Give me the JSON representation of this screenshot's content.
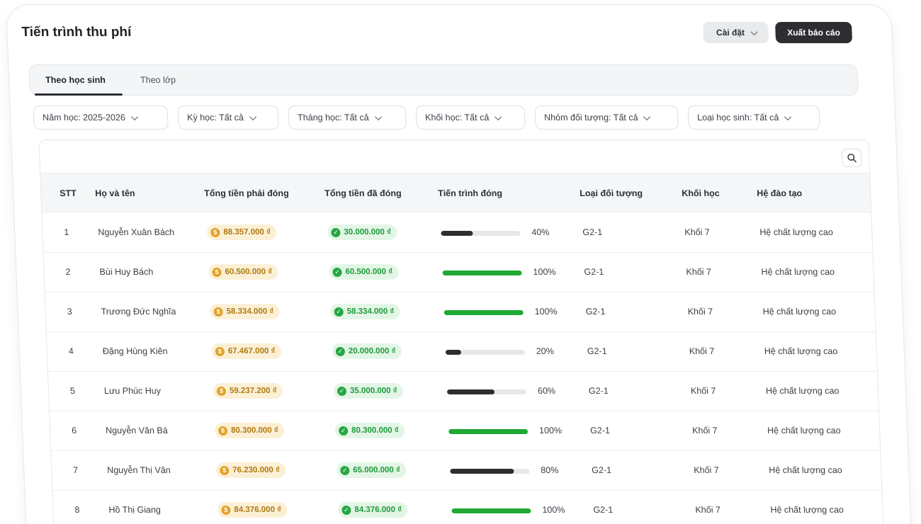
{
  "header": {
    "title": "Tiến trình thu phí",
    "settings_label": "Cài đặt",
    "export_label": "Xuất báo cáo"
  },
  "tabs": [
    {
      "label": "Theo học sinh",
      "active": true
    },
    {
      "label": "Theo lớp",
      "active": false
    }
  ],
  "filters": [
    {
      "label": "Năm học: 2025-2026"
    },
    {
      "label": "Kỳ học: Tất cả"
    },
    {
      "label": "Tháng học: Tất cả"
    },
    {
      "label": "Khối học: Tất cả"
    },
    {
      "label": "Nhóm đối tượng: Tất cả"
    },
    {
      "label": "Loại học sinh: Tất cả"
    }
  ],
  "table": {
    "columns": [
      "STT",
      "Họ và tên",
      "Tổng tiền phải đóng",
      "Tổng tiền đã đóng",
      "Tiến trình đóng",
      "Loại đối tượng",
      "Khối học",
      "Hệ đào tạo"
    ],
    "rows": [
      {
        "stt": "1",
        "name": "Nguyễn Xuân Bách",
        "due": "88.357.000 ₫",
        "paid": "30.000.000 ₫",
        "progress": 40,
        "progress_label": "40%",
        "type": "G2-1",
        "grade": "Khối 7",
        "system": "Hệ chất lượng cao"
      },
      {
        "stt": "2",
        "name": "Bùi Huy Bách",
        "due": "60.500.000 ₫",
        "paid": "60.500.000 ₫",
        "progress": 100,
        "progress_label": "100%",
        "type": "G2-1",
        "grade": "Khối 7",
        "system": "Hệ chất lượng cao"
      },
      {
        "stt": "3",
        "name": "Trương Đức Nghĩa",
        "due": "58.334.000 ₫",
        "paid": "58.334.000 ₫",
        "progress": 100,
        "progress_label": "100%",
        "type": "G2-1",
        "grade": "Khối 7",
        "system": "Hệ chất lượng cao"
      },
      {
        "stt": "4",
        "name": "Đặng Hùng Kiên",
        "due": "67.467.000 ₫",
        "paid": "20.000.000 ₫",
        "progress": 20,
        "progress_label": "20%",
        "type": "G2-1",
        "grade": "Khối 7",
        "system": "Hệ chất lượng cao"
      },
      {
        "stt": "5",
        "name": "Lưu Phúc Huy",
        "due": "59.237.200 ₫",
        "paid": "35.000.000 ₫",
        "progress": 60,
        "progress_label": "60%",
        "type": "G2-1",
        "grade": "Khối 7",
        "system": "Hệ chất lượng cao"
      },
      {
        "stt": "6",
        "name": "Nguyễn Văn Bá",
        "due": "80.300.000 ₫",
        "paid": "80.300.000 ₫",
        "progress": 100,
        "progress_label": "100%",
        "type": "G2-1",
        "grade": "Khối 7",
        "system": "Hệ chất lượng cao"
      },
      {
        "stt": "7",
        "name": "Nguyễn Thị Vân",
        "due": "76.230.000 ₫",
        "paid": "65.000.000 ₫",
        "progress": 80,
        "progress_label": "80%",
        "type": "G2-1",
        "grade": "Khối 7",
        "system": "Hệ chất lượng cao"
      },
      {
        "stt": "8",
        "name": "Hồ Thị Giang",
        "due": "84.376.000 ₫",
        "paid": "84.376.000 ₫",
        "progress": 100,
        "progress_label": "100%",
        "type": "G2-1",
        "grade": "Khối 7",
        "system": "Hệ chất lượng cao"
      }
    ]
  },
  "colors": {
    "progress_complete": "#1fa833",
    "progress_partial": "#2c2e31",
    "due_badge_bg": "#fbf0d6",
    "paid_badge_bg": "#e3f6e6"
  },
  "icons": {
    "search": "search-icon",
    "chevron": "chevron-down-icon",
    "due": "coin-icon",
    "paid": "check-circle-icon"
  }
}
